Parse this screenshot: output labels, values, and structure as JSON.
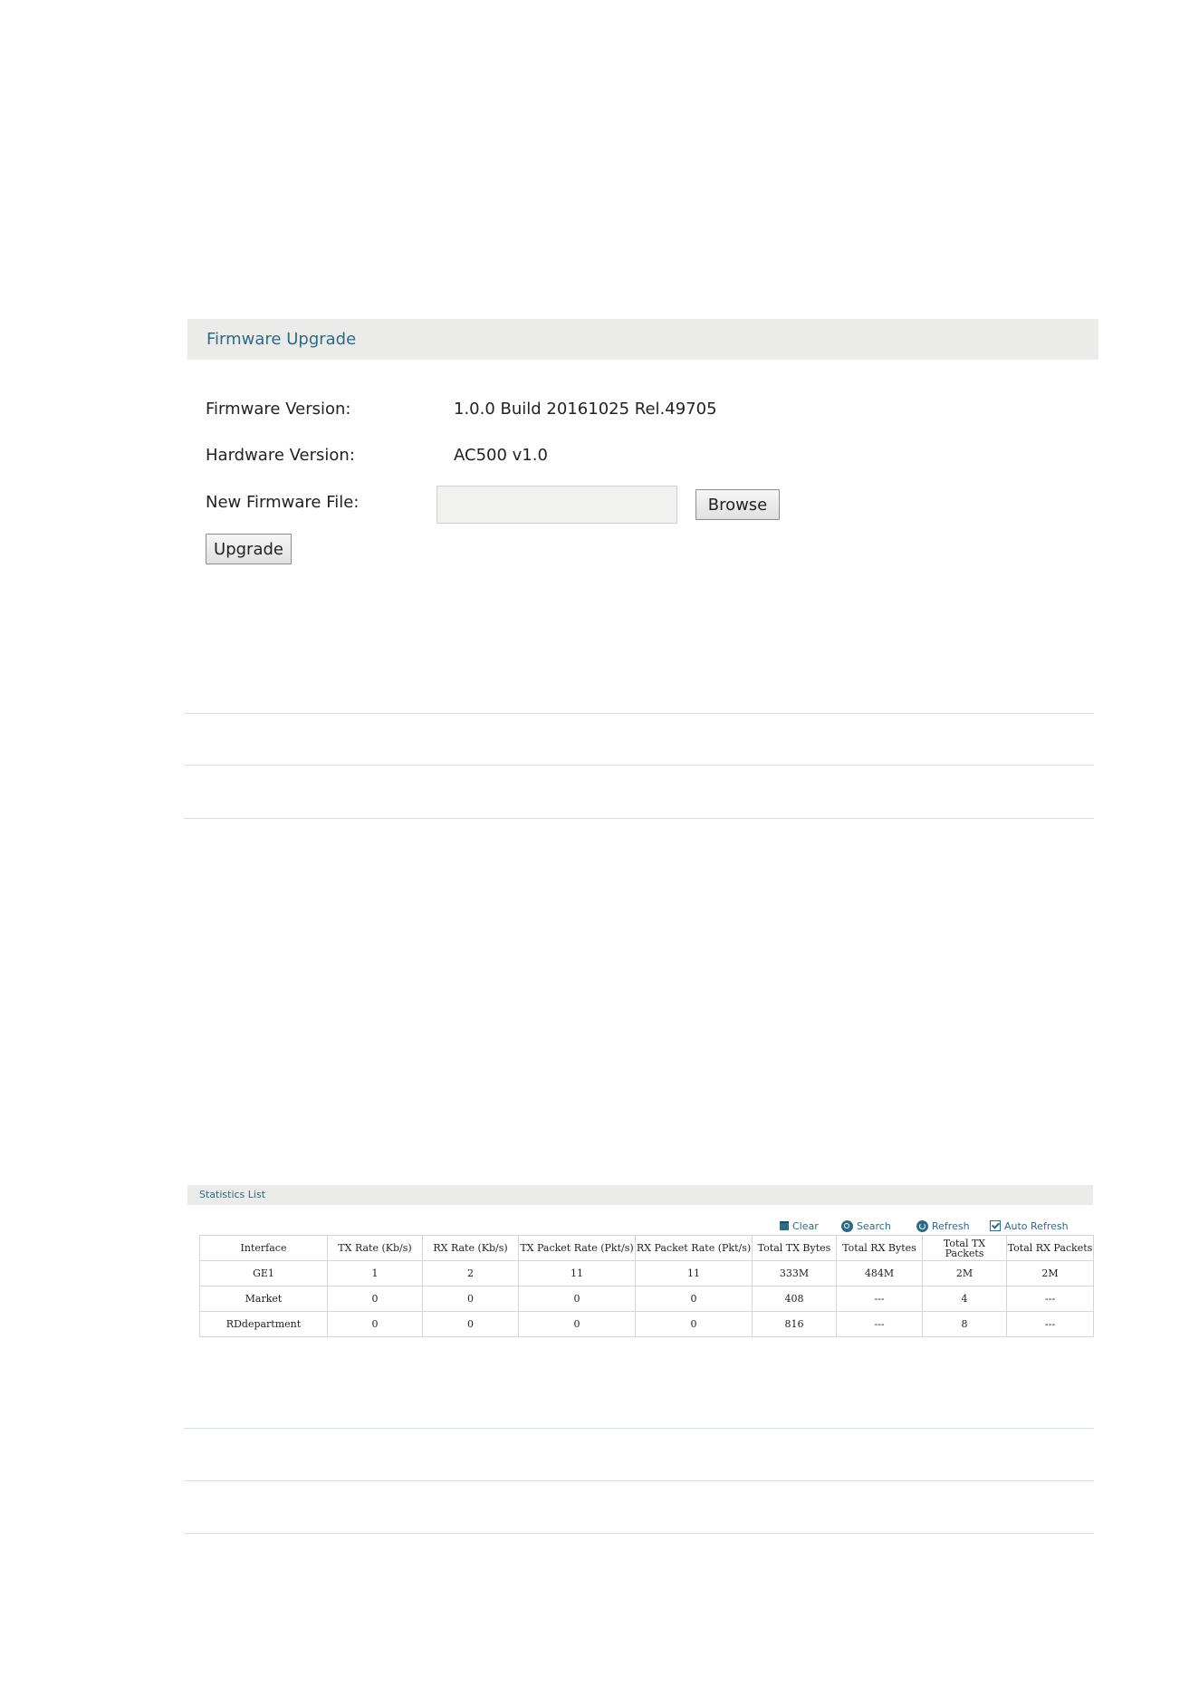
{
  "firmware_upgrade": {
    "title": "Firmware Upgrade",
    "firmware_version_label": "Firmware Version:",
    "firmware_version_value": "1.0.0 Build 20161025 Rel.49705",
    "hardware_version_label": "Hardware Version:",
    "hardware_version_value": "AC500 v1.0",
    "new_firmware_file_label": "New Firmware File:",
    "new_firmware_file_value": "",
    "browse_button": "Browse",
    "upgrade_button": "Upgrade"
  },
  "statistics_list": {
    "title": "Statistics List",
    "toolbar": {
      "clear": "Clear",
      "search": "Search",
      "refresh": "Refresh",
      "auto_refresh": "Auto Refresh",
      "auto_refresh_checked": true
    },
    "columns": [
      "Interface",
      "TX Rate (Kb/s)",
      "RX Rate (Kb/s)",
      "TX Packet Rate (Pkt/s)",
      "RX Packet Rate (Pkt/s)",
      "Total TX Bytes",
      "Total RX Bytes",
      "Total TX Packets",
      "Total RX Packets"
    ],
    "rows": [
      [
        "GE1",
        "1",
        "2",
        "11",
        "11",
        "333M",
        "484M",
        "2M",
        "2M"
      ],
      [
        "Market",
        "0",
        "0",
        "0",
        "0",
        "408",
        "---",
        "4",
        "---"
      ],
      [
        "RDdepartment",
        "0",
        "0",
        "0",
        "0",
        "816",
        "---",
        "8",
        "---"
      ]
    ]
  }
}
